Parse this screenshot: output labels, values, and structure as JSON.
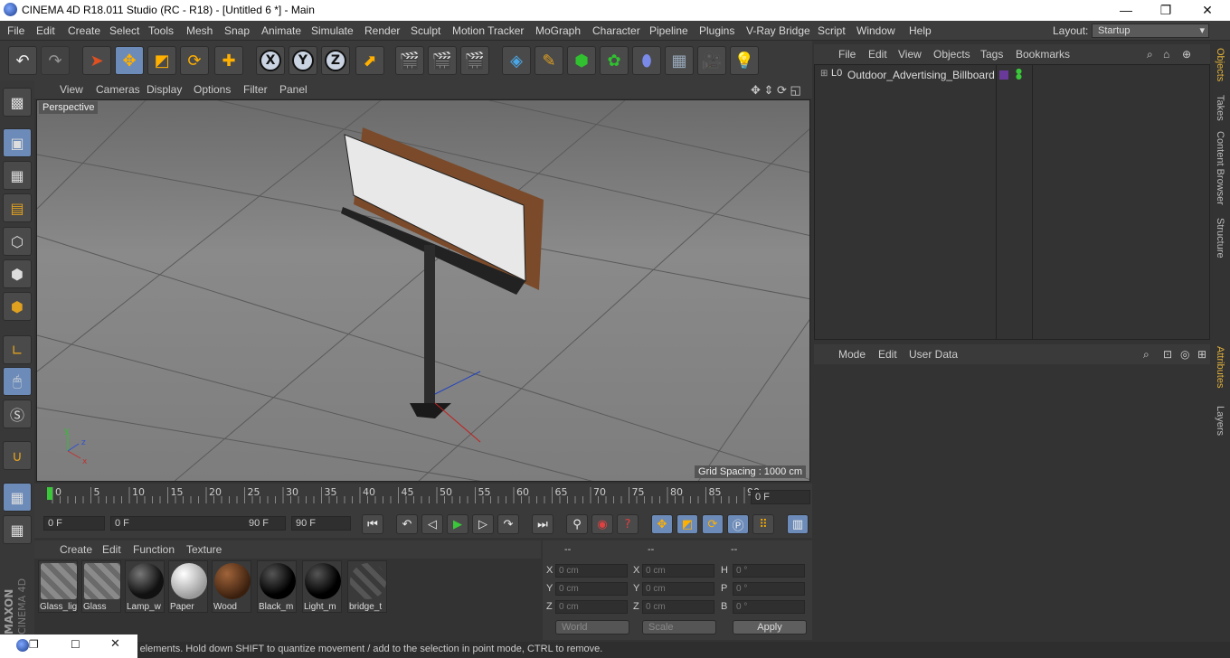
{
  "window": {
    "title": "CINEMA 4D R18.011 Studio (RC - R18) - [Untitled 6 *] - Main",
    "controls": [
      "—",
      "❐",
      "✕"
    ]
  },
  "menubar": {
    "items": [
      "File",
      "Edit",
      "Create",
      "Select",
      "Tools",
      "Mesh",
      "Snap",
      "Animate",
      "Simulate",
      "Render",
      "Sculpt",
      "Motion Tracker",
      "MoGraph",
      "Character",
      "Pipeline",
      "Plugins",
      "V-Ray Bridge",
      "Script",
      "Window",
      "Help"
    ],
    "layout_label": "Layout:",
    "layout_value": "Startup"
  },
  "viewport": {
    "menu": [
      "View",
      "Cameras",
      "Display",
      "Options",
      "Filter",
      "Panel"
    ],
    "camera_label": "Perspective",
    "grid_spacing": "Grid Spacing : 1000 cm"
  },
  "timeline": {
    "ticks": [
      "0",
      "5",
      "10",
      "15",
      "20",
      "25",
      "30",
      "35",
      "40",
      "45",
      "50",
      "55",
      "60",
      "65",
      "70",
      "75",
      "80",
      "85",
      "90"
    ],
    "current_frame": "0 F",
    "start_frame": "0 F",
    "range_start": "0 F",
    "range_end": "90 F",
    "end_frame": "90 F"
  },
  "materials": {
    "menu": [
      "Create",
      "Edit",
      "Function",
      "Texture"
    ],
    "items": [
      {
        "name": "Glass_lig",
        "kind": "stripe"
      },
      {
        "name": "Glass",
        "kind": "stripe"
      },
      {
        "name": "Lamp_w",
        "kind": "dark"
      },
      {
        "name": "Paper",
        "kind": "white"
      },
      {
        "name": "Wood",
        "kind": "wood"
      },
      {
        "name": "Black_m",
        "kind": "black"
      },
      {
        "name": "Light_m",
        "kind": "black"
      },
      {
        "name": "bridge_t",
        "kind": "stripe-dark"
      }
    ]
  },
  "coordinates": {
    "headers": [
      "--",
      "--",
      "--"
    ],
    "rows": [
      {
        "l1": "X",
        "v1": "0 cm",
        "l2": "X",
        "v2": "0 cm",
        "l3": "H",
        "v3": "0 °"
      },
      {
        "l1": "Y",
        "v1": "0 cm",
        "l2": "Y",
        "v2": "0 cm",
        "l3": "P",
        "v3": "0 °"
      },
      {
        "l1": "Z",
        "v1": "0 cm",
        "l2": "Z",
        "v2": "0 cm",
        "l3": "B",
        "v3": "0 °"
      }
    ],
    "world": "World",
    "scale": "Scale",
    "apply": "Apply"
  },
  "objects_panel": {
    "menu": [
      "File",
      "Edit",
      "View",
      "Objects",
      "Tags",
      "Bookmarks"
    ],
    "object_name": "Outdoor_Advertising_Billboard",
    "layer_icon": "L0"
  },
  "attributes_panel": {
    "menu": [
      "Mode",
      "Edit",
      "User Data"
    ]
  },
  "side_tabs": [
    "Objects",
    "Takes",
    "Content Browser",
    "Structure",
    "Attributes",
    "Layers"
  ],
  "status": {
    "text": "Move: Click and drag to move elements. Hold down SHIFT to quantize movement / add to the selection in point mode, CTRL to remove."
  },
  "brand": {
    "maxon": "MAXON",
    "cinema": "CINEMA 4D"
  },
  "colors": {
    "accent": "#6c8bb8",
    "background": "#333333",
    "play_green": "#3ac83a",
    "record_red": "#c83a3a"
  }
}
